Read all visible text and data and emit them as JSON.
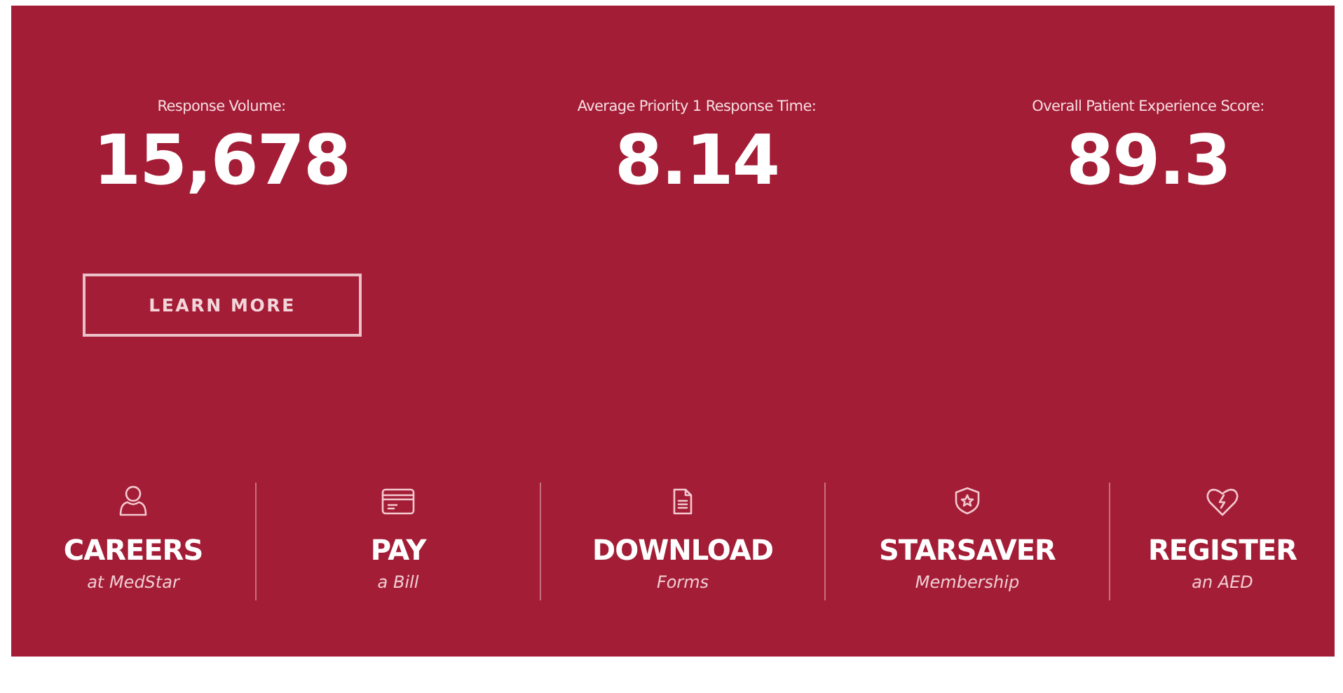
{
  "stats": [
    {
      "label": "Response Volume:",
      "value": "15,678"
    },
    {
      "label": "Average Priority 1 Response Time:",
      "value": "8.14"
    },
    {
      "label": "Overall Patient Experience Score:",
      "value": "89.3"
    }
  ],
  "learn_more_button": "LEARN MORE",
  "quick_links": [
    {
      "title": "CAREERS",
      "subtitle": "at MedStar"
    },
    {
      "title": "PAY",
      "subtitle": "a Bill"
    },
    {
      "title": "DOWNLOAD",
      "subtitle": "Forms"
    },
    {
      "title": "STARSAVER",
      "subtitle": "Membership"
    },
    {
      "title": "REGISTER",
      "subtitle": "an AED"
    }
  ]
}
